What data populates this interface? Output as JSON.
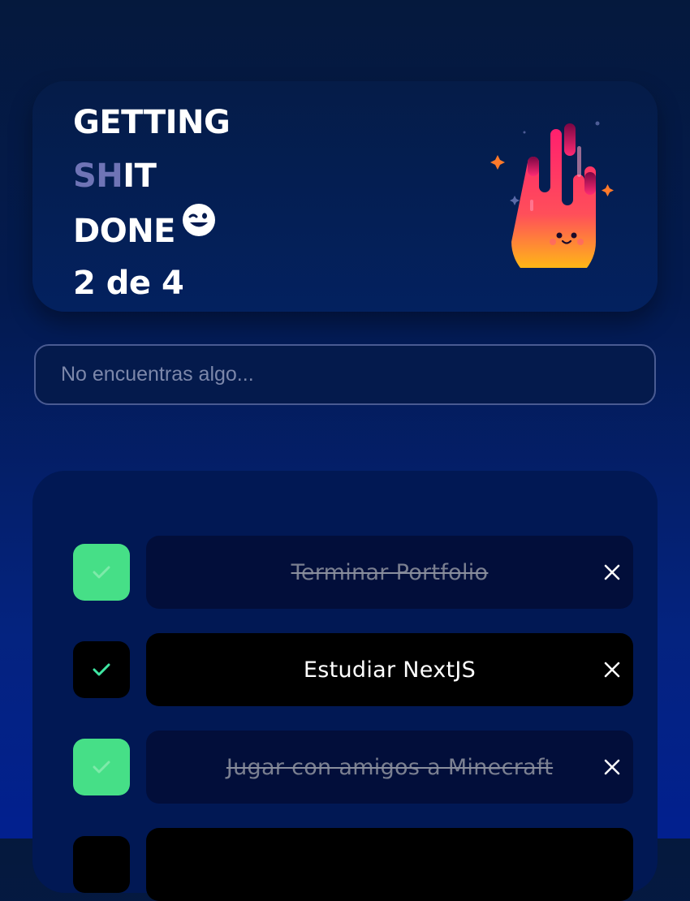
{
  "header": {
    "title_line1": "GETTING",
    "title_line2_a": "SH",
    "title_line2_b": "IT",
    "title_line3": "DONE",
    "counter": "2 de 4",
    "emoji_icon": "winking-face-icon",
    "illustration_icon": "cute-fire-mascot-icon"
  },
  "search": {
    "placeholder": "No encuentras algo...",
    "value": ""
  },
  "todos": [
    {
      "text": "Terminar Portfolio",
      "completed": true
    },
    {
      "text": "Estudiar NextJS",
      "completed": false
    },
    {
      "text": "Jugar con amigos a Minecraft",
      "completed": true
    },
    {
      "text": "",
      "completed": false
    }
  ],
  "colors": {
    "background_top": "#05193d",
    "background_bottom": "#02208f",
    "card": "#03215f",
    "panel": "#011854",
    "checked": "#46df87",
    "checkmark_on_green": "#7deaa9",
    "checkmark_on_black": "#3fe6a2",
    "title_muted": "#6f74b6"
  }
}
